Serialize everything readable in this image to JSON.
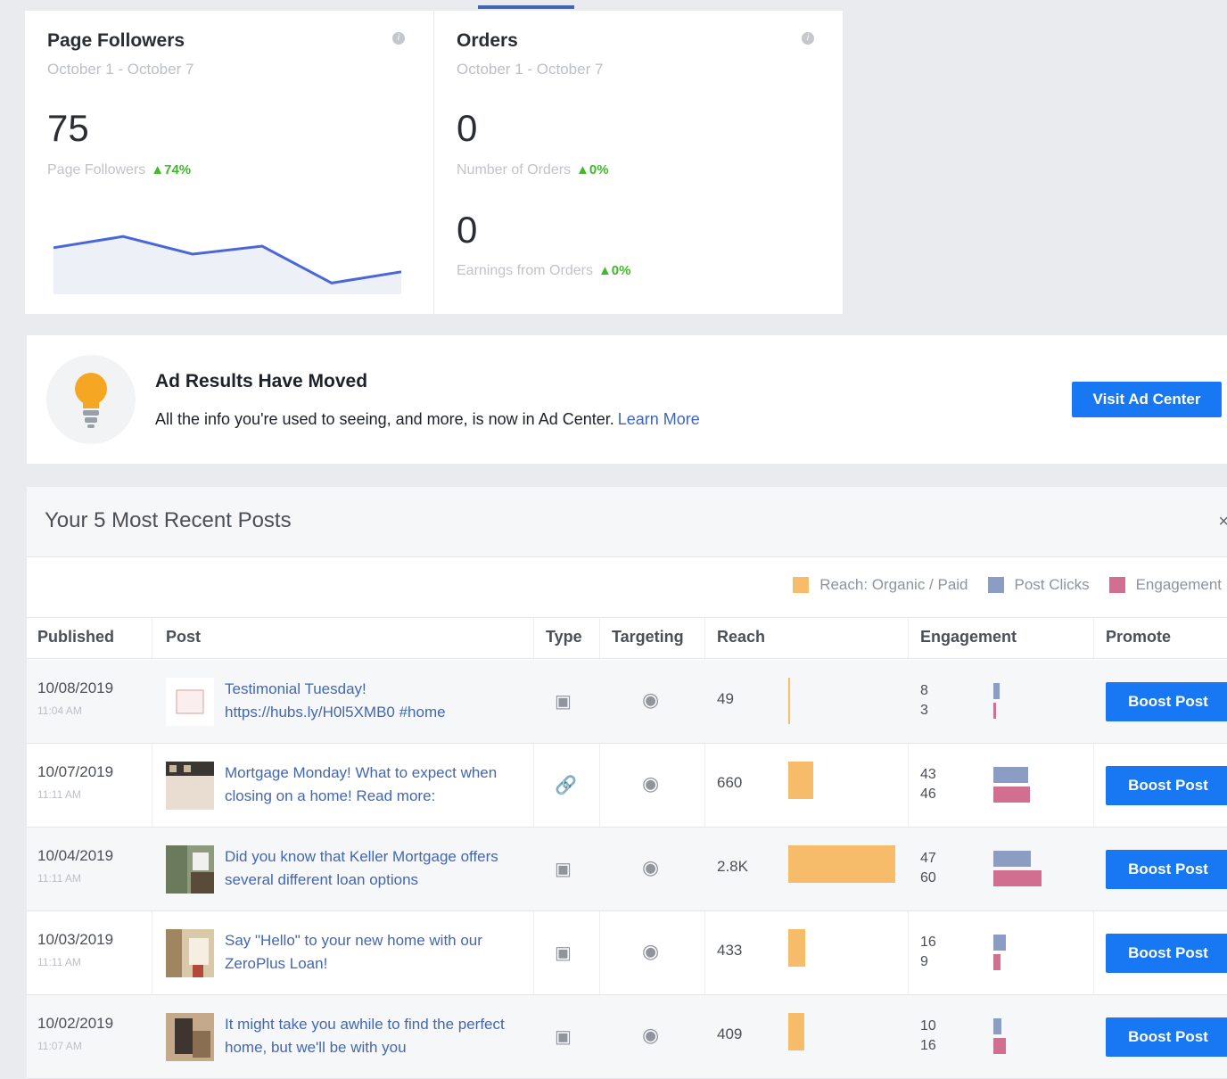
{
  "colors": {
    "accent": "#1877f2",
    "reach": "#f7bc6a",
    "clicks": "#8b9dc3",
    "engagement": "#d06f8f",
    "positive": "#42b72a"
  },
  "followers_card": {
    "title": "Page Followers",
    "date_range": "October 1 - October 7",
    "value": "75",
    "label": "Page Followers",
    "change": "▲74%",
    "sparkline": [
      0.42,
      0.28,
      0.5,
      0.4,
      0.86,
      0.72
    ]
  },
  "orders_card": {
    "title": "Orders",
    "date_range": "October 1 - October 7",
    "orders_value": "0",
    "orders_label": "Number of Orders",
    "orders_change": "▲0%",
    "earnings_value": "0",
    "earnings_label": "Earnings from Orders",
    "earnings_change": "▲0%"
  },
  "banner": {
    "title": "Ad Results Have Moved",
    "text": "All the info you're used to seeing, and more, is now in Ad Center.",
    "link": "Learn More",
    "button": "Visit Ad Center"
  },
  "posts": {
    "title": "Your 5 Most Recent Posts",
    "legend": {
      "reach": "Reach: Organic / Paid",
      "clicks": "Post Clicks",
      "engagement": "Engagement"
    },
    "columns": {
      "published": "Published",
      "post": "Post",
      "type": "Type",
      "targeting": "Targeting",
      "reach": "Reach",
      "engagement": "Engagement",
      "promote": "Promote"
    },
    "boost_label": "Boost Post",
    "rows": [
      {
        "date": "10/08/2019",
        "time": "11:04 AM",
        "text": "Testimonial Tuesday! https://hubs.ly/H0l5XMB0 #home",
        "reach": "49",
        "reach_value": 49,
        "clicks": "8",
        "clicks_value": 8,
        "eng": "3",
        "eng_value": 3
      },
      {
        "date": "10/07/2019",
        "time": "11:11 AM",
        "text": "Mortgage Monday! What to expect when closing on a home! Read more:",
        "reach": "660",
        "reach_value": 660,
        "clicks": "43",
        "clicks_value": 43,
        "eng": "46",
        "eng_value": 46
      },
      {
        "date": "10/04/2019",
        "time": "11:11 AM",
        "text": "Did you know that Keller Mortgage offers several different loan options",
        "reach": "2.8K",
        "reach_value": 2800,
        "clicks": "47",
        "clicks_value": 47,
        "eng": "60",
        "eng_value": 60
      },
      {
        "date": "10/03/2019",
        "time": "11:11 AM",
        "text": "Say \"Hello\" to your new home with our ZeroPlus Loan!",
        "reach": "433",
        "reach_value": 433,
        "clicks": "16",
        "clicks_value": 16,
        "eng": "9",
        "eng_value": 9
      },
      {
        "date": "10/02/2019",
        "time": "11:07 AM",
        "text": "It might take you awhile to find the perfect home, but we'll be with you",
        "reach": "409",
        "reach_value": 409,
        "clicks": "10",
        "clicks_value": 10,
        "eng": "16",
        "eng_value": 16
      }
    ]
  }
}
